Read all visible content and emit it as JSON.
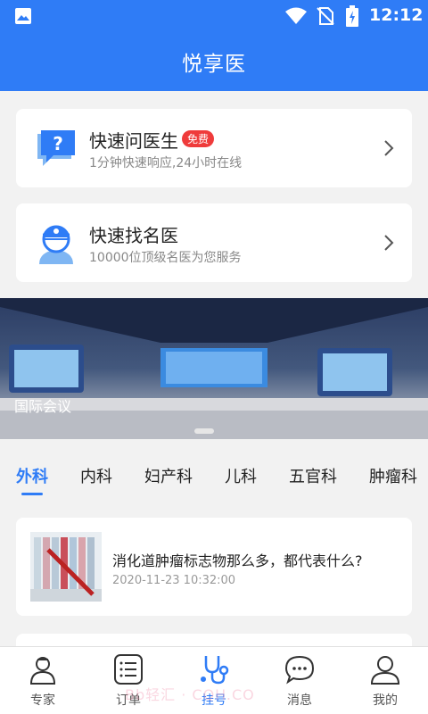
{
  "status_bar": {
    "time": "12:12"
  },
  "header": {
    "title": "悦享医"
  },
  "cards": [
    {
      "name": "快速问医生",
      "badge": "免费",
      "desc": "1分钟快速响应,24小时在线",
      "icon": "question-chat-icon"
    },
    {
      "name": "快速找名医",
      "desc": "10000位顶级名医为您服务",
      "icon": "doctor-avatar-icon"
    }
  ],
  "banner": {
    "caption": "国际会议"
  },
  "tabs": [
    "外科",
    "内科",
    "妇产科",
    "儿科",
    "五官科",
    "肿瘤科"
  ],
  "active_tab": "外科",
  "articles": [
    {
      "title": "消化道肿瘤标志物那么多，都代表什么?",
      "time": "2020-11-23 10:32:00"
    }
  ],
  "bottom_nav": [
    {
      "label": "专家",
      "icon": "doctor-icon"
    },
    {
      "label": "订单",
      "icon": "order-list-icon"
    },
    {
      "label": "挂号",
      "icon": "stethoscope-icon"
    },
    {
      "label": "消息",
      "icon": "message-icon"
    },
    {
      "label": "我的",
      "icon": "user-icon"
    }
  ],
  "active_nav": "挂号",
  "watermark": "Bb轻汇 · CQH.CO",
  "colors": {
    "primary": "#2f7cf6",
    "badge": "#ef3b3b",
    "background": "#f2f2f2"
  }
}
